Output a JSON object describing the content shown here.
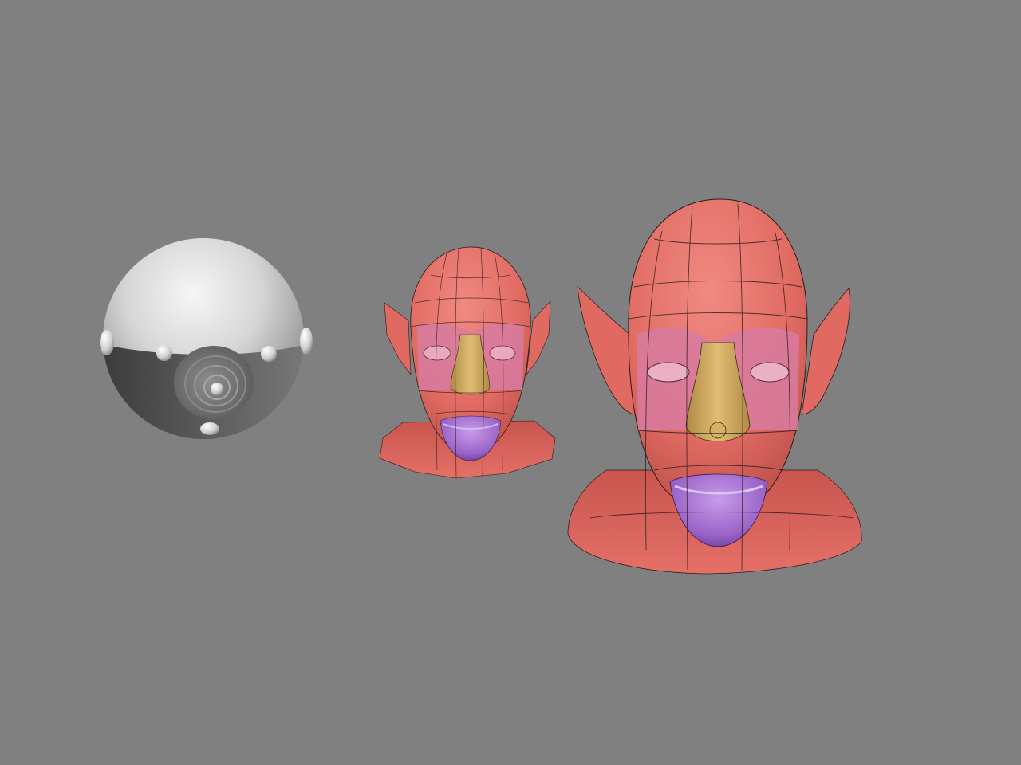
{
  "scene": {
    "background_color": "#808080",
    "objects": [
      {
        "name": "base-sphere",
        "kind": "sphere",
        "description_hidden": true
      },
      {
        "name": "head-low-res",
        "kind": "head-mesh"
      },
      {
        "name": "head-high-res",
        "kind": "head-mesh"
      }
    ],
    "colors": {
      "skin": "#e06a62",
      "skin_dark": "#9a3e38",
      "eye_region": "#d77ba0",
      "nose": "#c9a35a",
      "mouth": "#9a64c8",
      "wire": "#2a1a1a",
      "sphere_light": "#f2f2f2",
      "sphere_dark": "#3a3a3a"
    }
  }
}
